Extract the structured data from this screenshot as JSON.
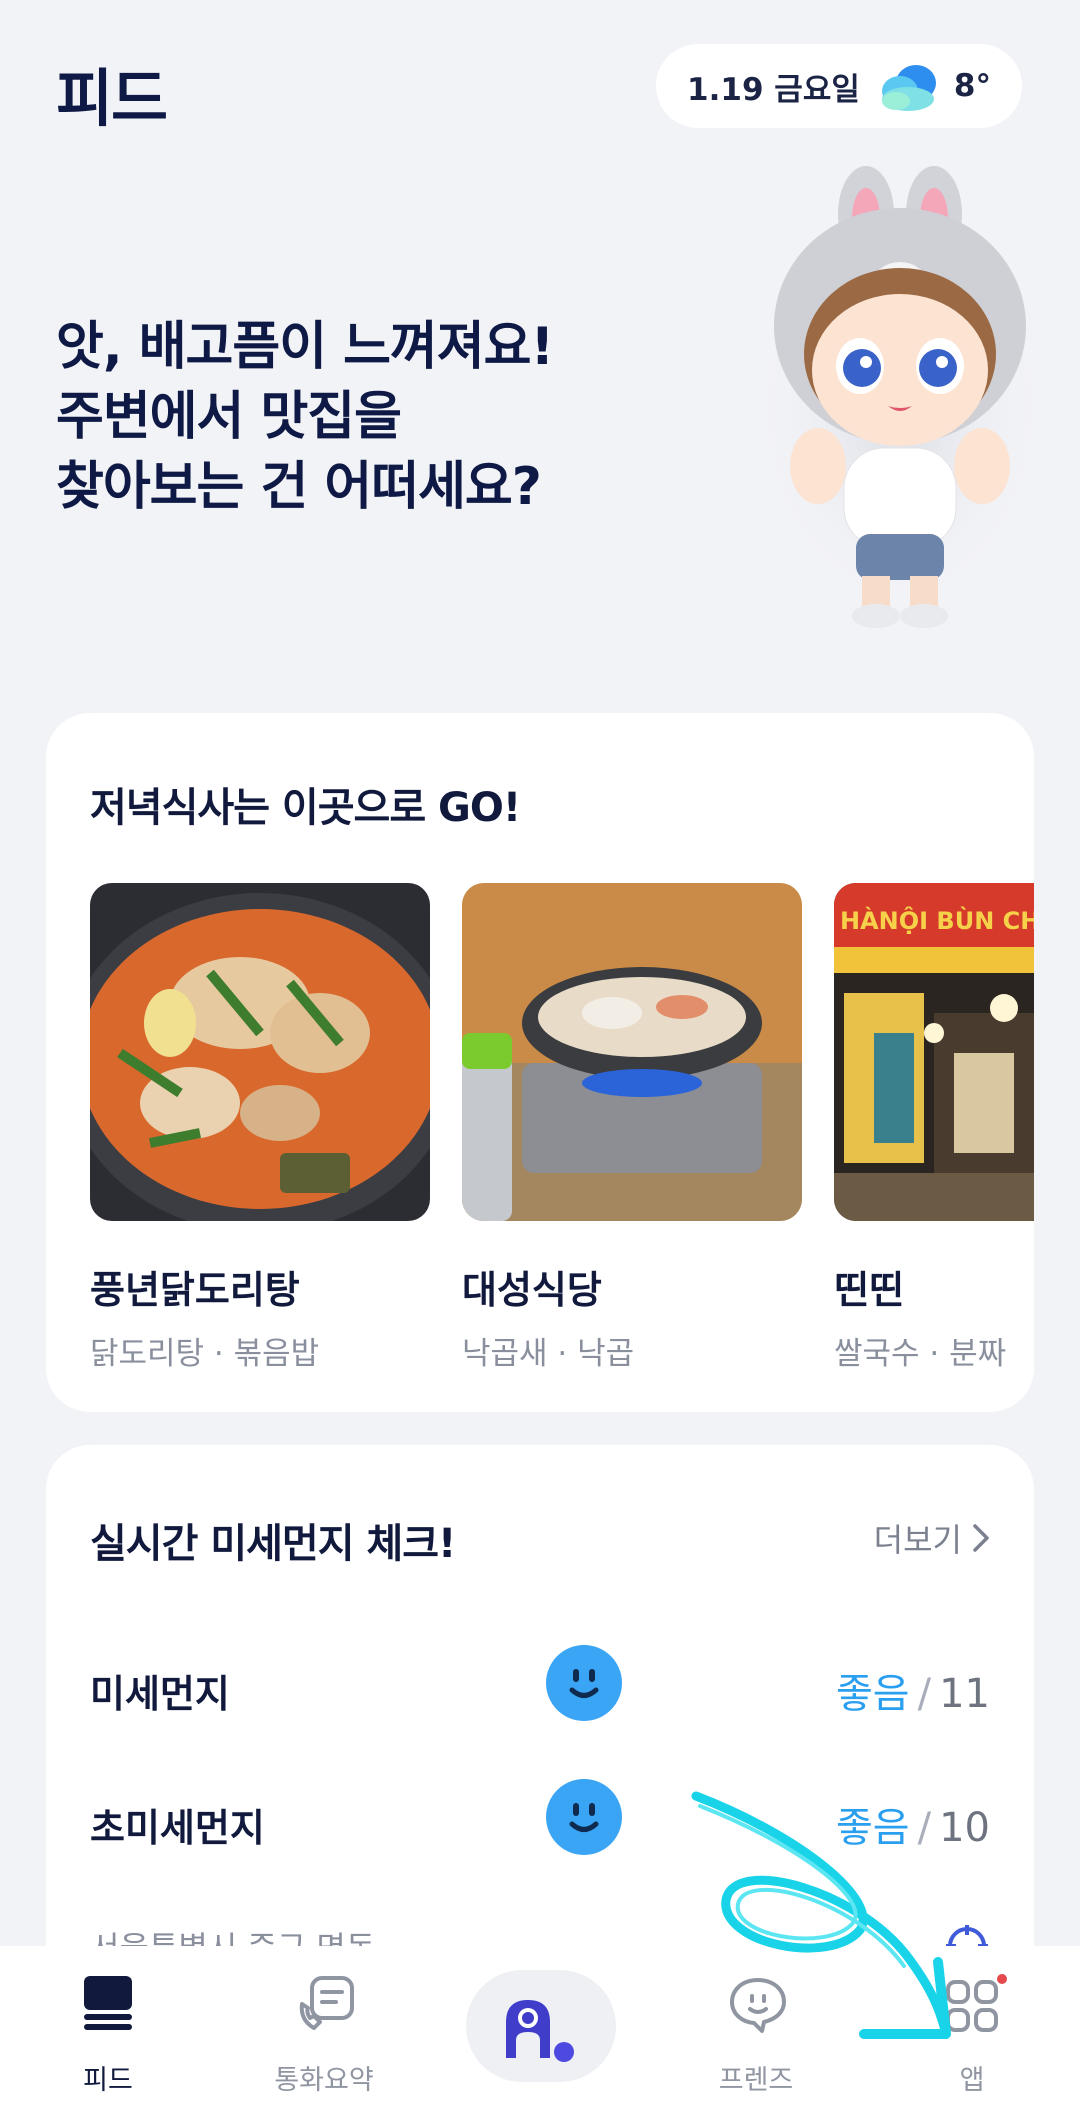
{
  "header": {
    "title": "피드",
    "weather": {
      "date": "1.19 금요일",
      "temperature": "8°",
      "icon": "cloud-icon"
    }
  },
  "hero": {
    "lines": [
      "앗, 배고픔이 느껴져요!",
      "주변에서 맛집을",
      "찾아보는 건 어떠세요?"
    ]
  },
  "dinner_card": {
    "title": "저녁식사는 이곳으로 GO!",
    "places": [
      {
        "name": "풍년닭도리탕",
        "tags": "닭도리탕 · 볶음밥"
      },
      {
        "name": "대성식당",
        "tags": "낙곱새 · 낙곱"
      },
      {
        "name": "띤띤",
        "tags": "쌀국수 · 분짜",
        "sign_text": "HÀNỘI BÙN CH"
      }
    ]
  },
  "dust_card": {
    "title": "실시간 미세먼지 체크!",
    "more_label": "더보기",
    "rows": [
      {
        "label": "미세먼지",
        "grade": "좋음",
        "separator": "/",
        "value": "11"
      },
      {
        "label": "초미세먼지",
        "grade": "좋음",
        "separator": "/",
        "value": "10"
      }
    ],
    "location": "서울특별시 중구 명동"
  },
  "nav": {
    "items": [
      {
        "label": "피드",
        "icon": "feed-icon",
        "active": true
      },
      {
        "label": "통화요약",
        "icon": "call-summary-icon"
      },
      {
        "label": "",
        "icon": "assistant-icon"
      },
      {
        "label": "프렌즈",
        "icon": "friends-chat-icon"
      },
      {
        "label": "앱",
        "icon": "apps-grid-icon"
      }
    ]
  },
  "colors": {
    "background": "#F2F3F7",
    "title": "#0E1A45",
    "accent_blue": "#2A9FF0",
    "face_blue": "#3AA5F5",
    "nav_brand": "#3F3DC9",
    "annotation_cyan": "#19D3E8",
    "notification_dot": "#E5484D"
  }
}
